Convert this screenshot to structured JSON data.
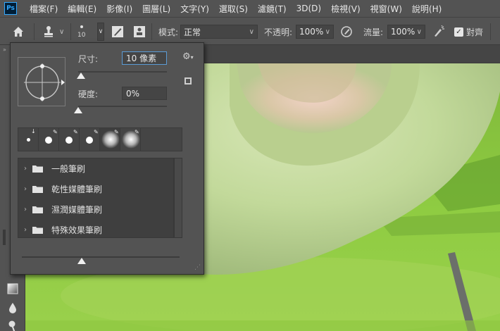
{
  "app": {
    "logo": "Ps",
    "menu": [
      "檔案(F)",
      "編輯(E)",
      "影像(I)",
      "圖層(L)",
      "文字(Y)",
      "選取(S)",
      "濾鏡(T)",
      "3D(D)",
      "檢視(V)",
      "視窗(W)",
      "說明(H)"
    ]
  },
  "options_bar": {
    "home_icon": "home-icon",
    "tool_icon": "clone-stamp-icon",
    "brush_size": "10",
    "mode_label": "模式:",
    "mode_value": "正常",
    "opacity_label": "不透明:",
    "opacity_value": "100%",
    "flow_label": "流量:",
    "flow_value": "100%",
    "aligned_label": "對齊",
    "aligned_checked": true
  },
  "brush_popup": {
    "size_label": "尺寸:",
    "size_value": "10 像素",
    "size_slider": 0.03,
    "hardness_label": "硬度:",
    "hardness_value": "0%",
    "hardness_slider": 0.0,
    "presets": [
      {
        "kind": "small-hard",
        "badge": "↓"
      },
      {
        "kind": "hard"
      },
      {
        "kind": "hard"
      },
      {
        "kind": "hard"
      },
      {
        "kind": "soft",
        "selected": true
      },
      {
        "kind": "soft"
      }
    ],
    "folders": [
      {
        "name": "一般筆刷"
      },
      {
        "name": "乾性媒體筆刷"
      },
      {
        "name": "濕潤媒體筆刷"
      },
      {
        "name": "特殊效果筆刷"
      }
    ],
    "bottom_slider": 0.38
  },
  "colors": {
    "ui_bg": "#535353",
    "canvas_green": "#8dc83c",
    "accent_blue": "#31a8ff"
  }
}
